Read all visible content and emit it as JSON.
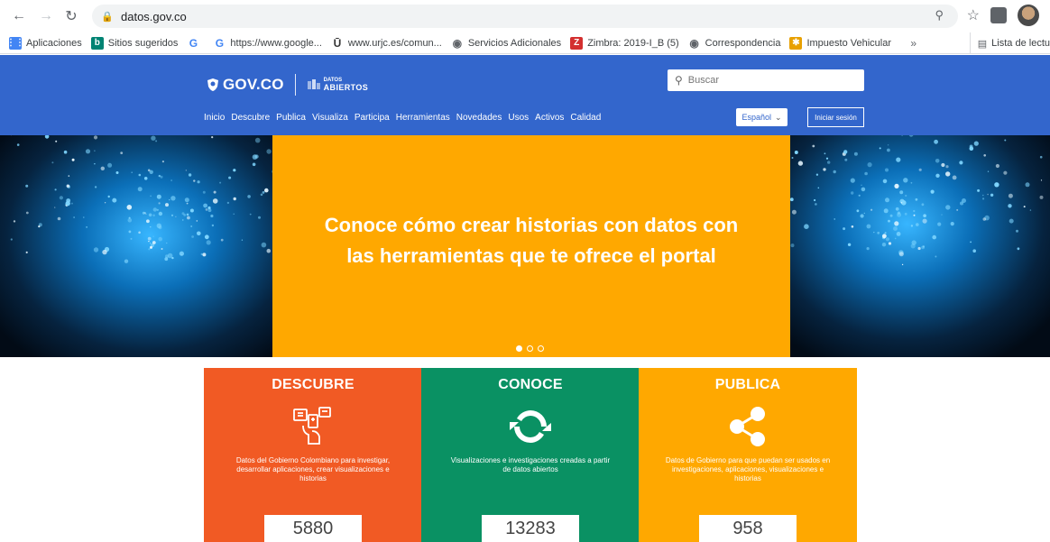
{
  "browser": {
    "url": "datos.gov.co",
    "bookmarks": [
      {
        "label": "Aplicaciones",
        "icon": "apps-grid-icon",
        "color": "#4285f4"
      },
      {
        "label": "Sitios sugeridos",
        "icon": "bing-icon",
        "color": "#008373"
      },
      {
        "label": "",
        "icon": "google-icon",
        "color": "#4285f4"
      },
      {
        "label": "https://www.google...",
        "icon": "google-icon",
        "color": "#4285f4"
      },
      {
        "label": "www.urjc.es/comun...",
        "icon": "urjc-icon",
        "color": "#333333"
      },
      {
        "label": "Servicios Adicionales",
        "icon": "globe-icon",
        "color": "#5f6368"
      },
      {
        "label": "Zimbra: 2019-I_B (5)",
        "icon": "zimbra-icon",
        "color": "#d32f2f"
      },
      {
        "label": "Correspondencia",
        "icon": "globe-icon",
        "color": "#5f6368"
      },
      {
        "label": "Impuesto Vehicular",
        "icon": "star-badge-icon",
        "color": "#e8a000"
      }
    ],
    "more": "»",
    "reading_list": "Lista de lectu"
  },
  "site": {
    "brand": "GOV.CO",
    "datos_small": "DATOS",
    "datos_big": "ABIERTOS",
    "search_placeholder": "Buscar",
    "nav": [
      "Inicio",
      "Descubre",
      "Publica",
      "Visualiza",
      "Participa",
      "Herramientas",
      "Novedades",
      "Usos",
      "Activos",
      "Calidad"
    ],
    "language": "Español",
    "login": "Iniciar sesión"
  },
  "hero": {
    "title": "Conoce cómo crear historias con datos con las herramientas que te ofrece el portal",
    "slides": 3,
    "active_slide": 0
  },
  "cards": [
    {
      "title": "DESCUBRE",
      "desc": "Datos del Gobierno Colombiano para investigar, desarrollar aplicaciones, crear visualizaciones e historias",
      "count": "5880",
      "color": "#f15a24",
      "icon": "devices-icon"
    },
    {
      "title": "CONOCE",
      "desc": "Visualizaciones e investigaciones creadas a partir de datos abiertos",
      "count": "13283",
      "color": "#0a9163",
      "icon": "refresh-cycle-icon"
    },
    {
      "title": "PUBLICA",
      "desc": "Datos de Gobierno para que puedan ser usados en investigaciones, aplicaciones, visualizaciones e historias",
      "count": "958",
      "color": "#ffa800",
      "icon": "share-icon"
    }
  ]
}
